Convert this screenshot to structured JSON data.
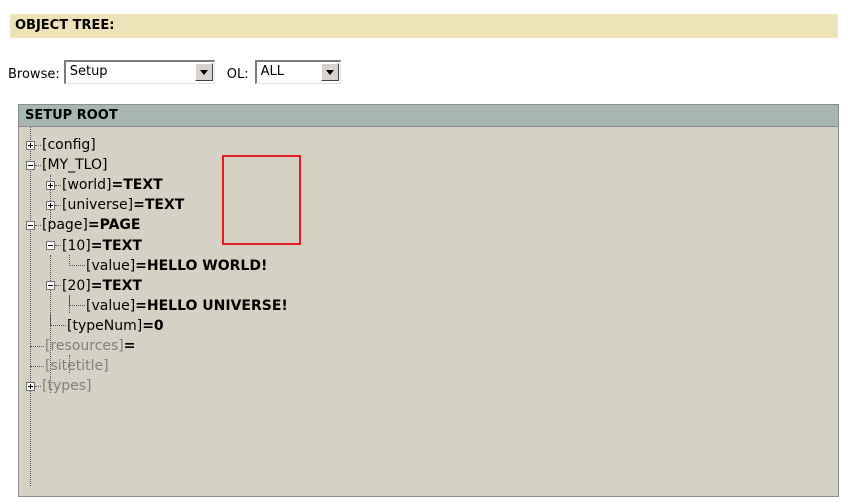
{
  "header": {
    "title": "OBJECT TREE:"
  },
  "browse": {
    "browse_label": "Browse:",
    "browse_value": "Setup",
    "ol_label": "OL:",
    "ol_value": "ALL"
  },
  "tree": {
    "root_label": "SETUP ROOT",
    "nodes": [
      {
        "key": "[config]"
      },
      {
        "key": "[MY_TLO]"
      },
      {
        "key": "[world]",
        "value": "=TEXT"
      },
      {
        "key": "[universe]",
        "value": "=TEXT"
      },
      {
        "key": "[page]",
        "value": "=PAGE"
      },
      {
        "key": "[10]",
        "value": "=TEXT"
      },
      {
        "key": "[value]",
        "value": "=HELLO WORLD!"
      },
      {
        "key": "[20]",
        "value": "=TEXT"
      },
      {
        "key": "[value]",
        "value": "=HELLO UNIVERSE!"
      },
      {
        "key": "[typeNum]",
        "value": "=0"
      },
      {
        "key": "[resources]",
        "value": "="
      },
      {
        "key": "[sitetitle]"
      },
      {
        "key": "[types]"
      }
    ]
  },
  "colors": {
    "header_bg": "#eee2b8",
    "tree_bg": "#d5d1c4",
    "tree_header_bg": "#a8b6b1",
    "highlight_border": "#e02020",
    "inactive_text": "#808080"
  }
}
